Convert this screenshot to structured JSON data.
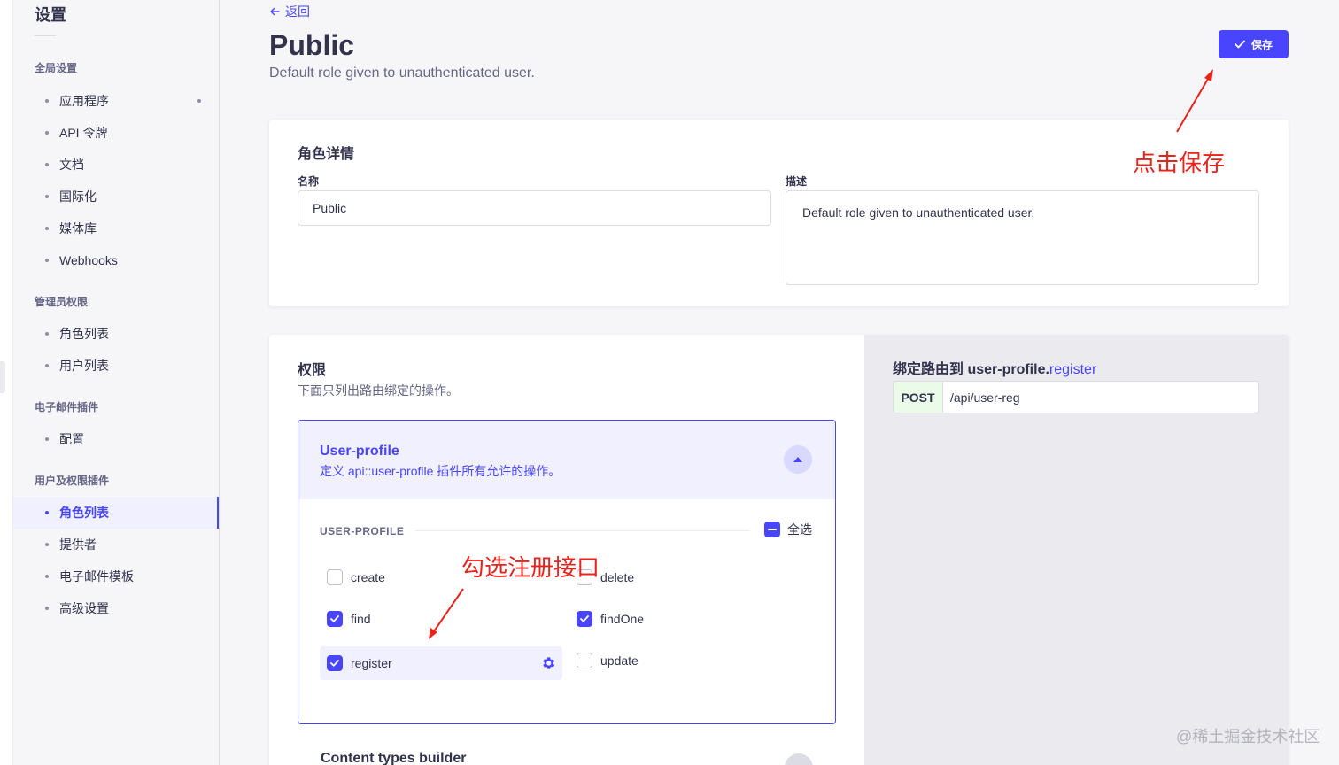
{
  "sidebar": {
    "title": "设置",
    "sections": [
      {
        "label": "全局设置",
        "items": [
          "应用程序",
          "API 令牌",
          "文档",
          "国际化",
          "媒体库",
          "Webhooks"
        ]
      },
      {
        "label": "管理员权限",
        "items": [
          "角色列表",
          "用户列表"
        ]
      },
      {
        "label": "电子邮件插件",
        "items": [
          "配置"
        ]
      },
      {
        "label": "用户及权限插件",
        "items": [
          "角色列表",
          "提供者",
          "电子邮件模板",
          "高级设置"
        ]
      }
    ],
    "active_item": "角色列表"
  },
  "header": {
    "back_label": "返回",
    "title": "Public",
    "subtitle": "Default role given to unauthenticated user.",
    "save_label": "保存"
  },
  "details": {
    "heading": "角色详情",
    "name_label": "名称",
    "name_value": "Public",
    "desc_label": "描述",
    "desc_value": "Default role given to unauthenticated user."
  },
  "permissions": {
    "heading": "权限",
    "subtitle": "下面只列出路由绑定的操作。",
    "plugin_title": "User-profile",
    "plugin_desc": "定义 api::user-profile 插件所有允许的操作。",
    "group_label": "USER-PROFILE",
    "select_all_label": "全选",
    "actions": [
      {
        "label": "create",
        "checked": false
      },
      {
        "label": "delete",
        "checked": false
      },
      {
        "label": "find",
        "checked": true
      },
      {
        "label": "findOne",
        "checked": true
      },
      {
        "label": "register",
        "checked": true
      },
      {
        "label": "update",
        "checked": false
      }
    ],
    "next_plugin_title": "Content types builder"
  },
  "bound_route": {
    "title_prefix": "绑定路由到 user-profile.",
    "title_action": "register",
    "method": "POST",
    "path": "/api/user-reg"
  },
  "annotations": {
    "save_hint": "点击保存",
    "register_hint": "勾选注册接口"
  },
  "watermark": "@稀土掘金技术社区",
  "colors": {
    "primary": "#4945ff",
    "annotation": "#e8231c",
    "post_badge_bg": "#eafbe7"
  }
}
